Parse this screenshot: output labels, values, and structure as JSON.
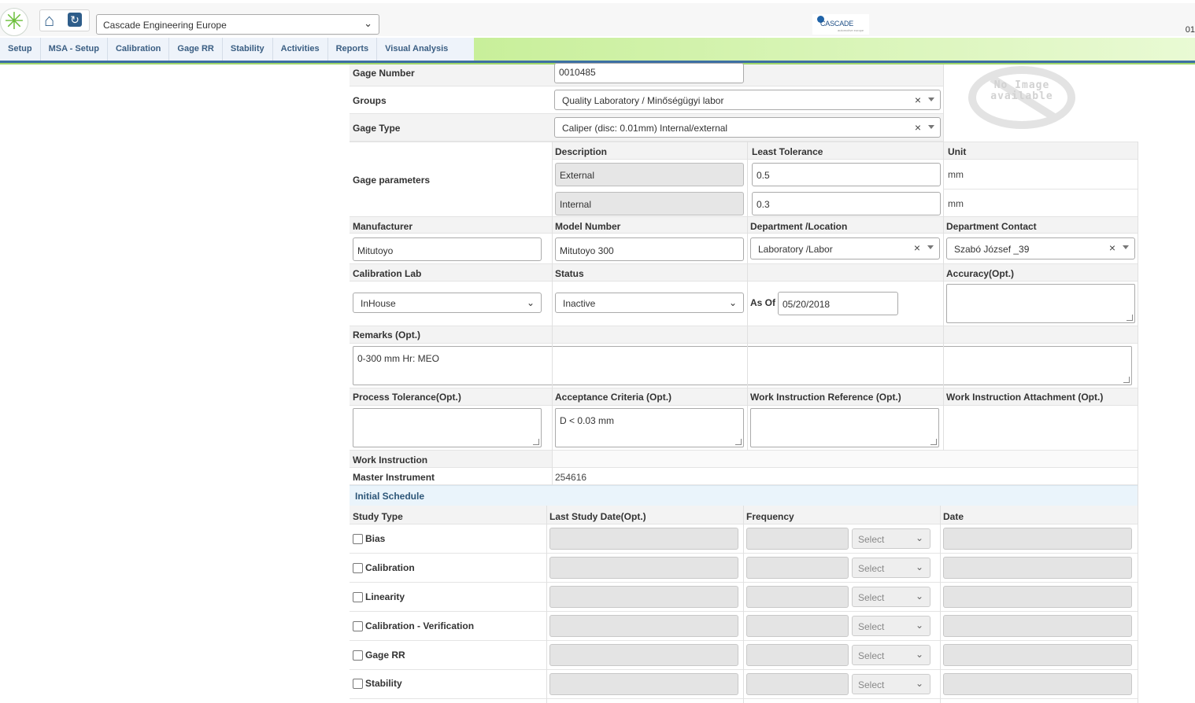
{
  "header": {
    "company": "Cascade Engineering Europe",
    "brand_name": "CASCADE",
    "brand_sub": "automotive europe",
    "corner_text": "01"
  },
  "nav": [
    "Setup",
    "MSA - Setup",
    "Calibration",
    "Gage RR",
    "Stability",
    "Activities",
    "Reports",
    "Visual Analysis"
  ],
  "form": {
    "gage_number_label": "Gage Number",
    "gage_number": "0010485",
    "groups_label": "Groups",
    "groups": "Quality Laboratory / Minőségügyi labor",
    "gage_type_label": "Gage Type",
    "gage_type": "Caliper (disc: 0.01mm) Internal/external",
    "no_image_line1": "No Image",
    "no_image_line2": "available",
    "gage_parameters_label": "Gage parameters",
    "param_headers": {
      "description": "Description",
      "least_tolerance": "Least Tolerance",
      "unit": "Unit"
    },
    "params": [
      {
        "description": "External",
        "tolerance": "0.5",
        "unit": "mm"
      },
      {
        "description": "Internal",
        "tolerance": "0.3",
        "unit": "mm"
      }
    ],
    "manufacturer_label": "Manufacturer",
    "manufacturer": "Mitutoyo",
    "model_label": "Model Number",
    "model": "Mitutoyo 300",
    "department_label": "Department /Location",
    "department": "Laboratory /Labor",
    "contact_label": "Department Contact",
    "contact": "Szabó József _39",
    "cal_lab_label": "Calibration Lab",
    "cal_lab": "InHouse",
    "status_label": "Status",
    "status": "Inactive",
    "as_of_label": "As Of",
    "as_of": "05/20/2018",
    "accuracy_label": "Accuracy(Opt.)",
    "remarks_label": "Remarks (Opt.)",
    "remarks": "0-300 mm Hr: MEO",
    "process_tol_label": "Process Tolerance(Opt.)",
    "acceptance_label": "Acceptance Criteria (Opt.)",
    "acceptance": "D < 0.03 mm",
    "wi_ref_label": "Work Instruction Reference (Opt.)",
    "wi_attach_label": "Work Instruction Attachment (Opt.)",
    "work_instruction_label": "Work Instruction",
    "master_label": "Master Instrument",
    "master": "254616"
  },
  "schedule": {
    "title": "Initial Schedule",
    "headers": {
      "study_type": "Study Type",
      "last_study": "Last Study Date(Opt.)",
      "frequency": "Frequency",
      "date": "Date"
    },
    "select_placeholder": "Select",
    "rows": [
      "Bias",
      "Calibration",
      "Linearity",
      "Calibration - Verification",
      "Gage RR",
      "Stability"
    ]
  }
}
